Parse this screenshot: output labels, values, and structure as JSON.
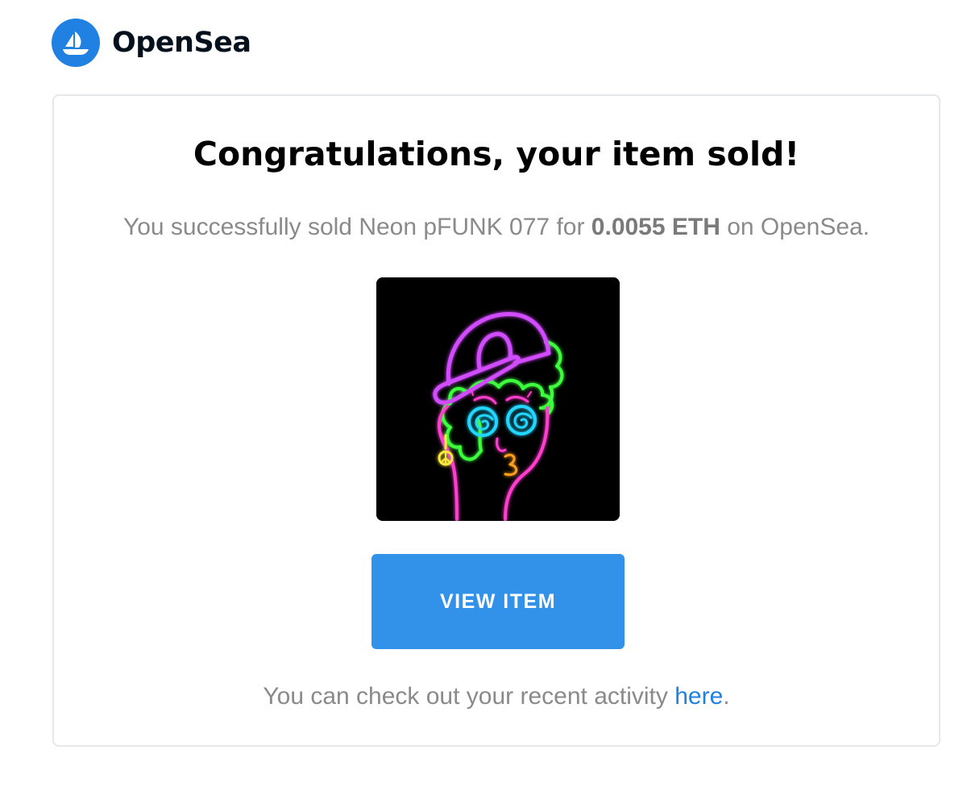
{
  "brand": {
    "name": "OpenSea",
    "logo_icon": "opensea-boat-icon",
    "color": "#2081e2"
  },
  "email": {
    "title": "Congratulations, your item sold!",
    "message": {
      "prefix": "You successfully sold Neon pFUNK 077 for ",
      "price": "0.0055 ETH",
      "suffix": " on OpenSea."
    },
    "image_alt": "Neon pFUNK 077",
    "button_label": "VIEW ITEM",
    "button_color": "#3291e9",
    "footer": {
      "prefix": "You can check out your recent activity ",
      "link": "here",
      "suffix": "."
    }
  }
}
